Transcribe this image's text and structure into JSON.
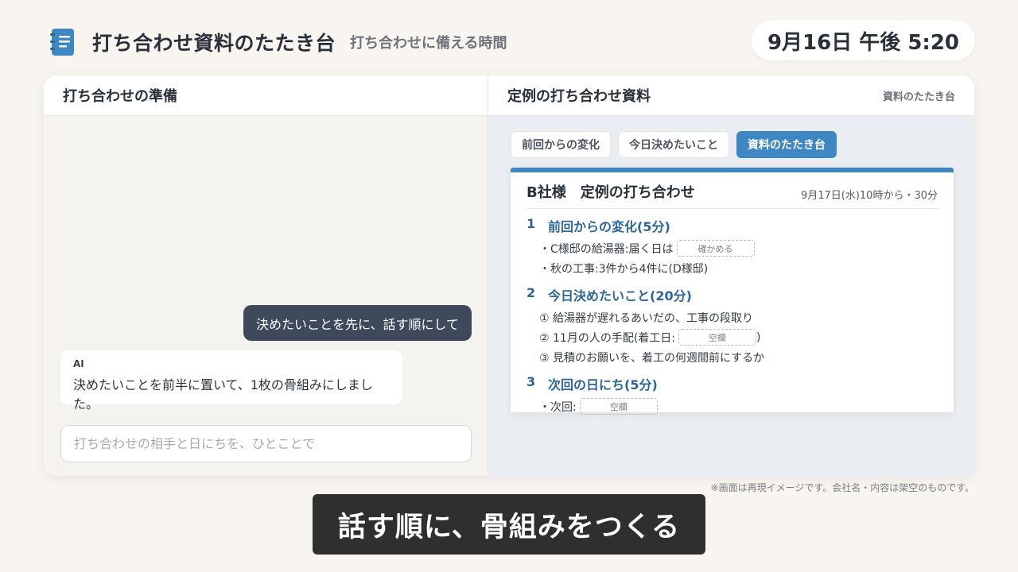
{
  "header": {
    "app_icon": "notebook-icon",
    "title": "打ち合わせ資料のたたき台",
    "subtitle": "打ち合わせに備える時間",
    "datetime": "9月16日 午後 5:20"
  },
  "colors": {
    "accent": "#3f87c3",
    "user_bubble": "#3e4a5c",
    "section_heading": "#2c6596",
    "caption_bg": "#2f2f2f"
  },
  "left_pane": {
    "title": "打ち合わせの準備",
    "user_message": "決めたいことを先に、話す順にして",
    "ai_label": "AI",
    "ai_message": "決めたいことを前半に置いて、1枚の骨組みにしました。",
    "input_placeholder": "打ち合わせの相手と日にちを、ひとことで"
  },
  "right_pane": {
    "title": "定例の打ち合わせ資料",
    "tag": "資料のたたき台",
    "tabs": [
      {
        "label": "前回からの変化",
        "active": false
      },
      {
        "label": "今日決めたいこと",
        "active": false
      },
      {
        "label": "資料のたたき台",
        "active": true
      }
    ],
    "doc": {
      "title": "B社様　定例の打ち合わせ",
      "when": "9月17日(水)10時から・30分",
      "sections": [
        {
          "num": "1",
          "title": "前回からの変化(5分)",
          "l1": "・C様邸の給湯器:届く日は",
          "l1_blank": "確かめる",
          "l2": "・秋の工事:3件から4件に(D様邸)"
        },
        {
          "num": "2",
          "title": "今日決めたいこと(20分)",
          "l1": "① 給湯器が遅れるあいだの、工事の段取り",
          "l2": "② 11月の人の手配(着工日:",
          "l2_blank": "空欄",
          "l2_end": ")",
          "l3": "③ 見積のお願いを、着工の何週間前にするか"
        },
        {
          "num": "3",
          "title": "次回の日にち(5分)",
          "l1": "・次回:",
          "l1_blank": "空欄"
        }
      ]
    }
  },
  "disclaimer": "※画面は再現イメージです。会社名・内容は架空のものです。",
  "caption": "話す順に、骨組みをつくる"
}
